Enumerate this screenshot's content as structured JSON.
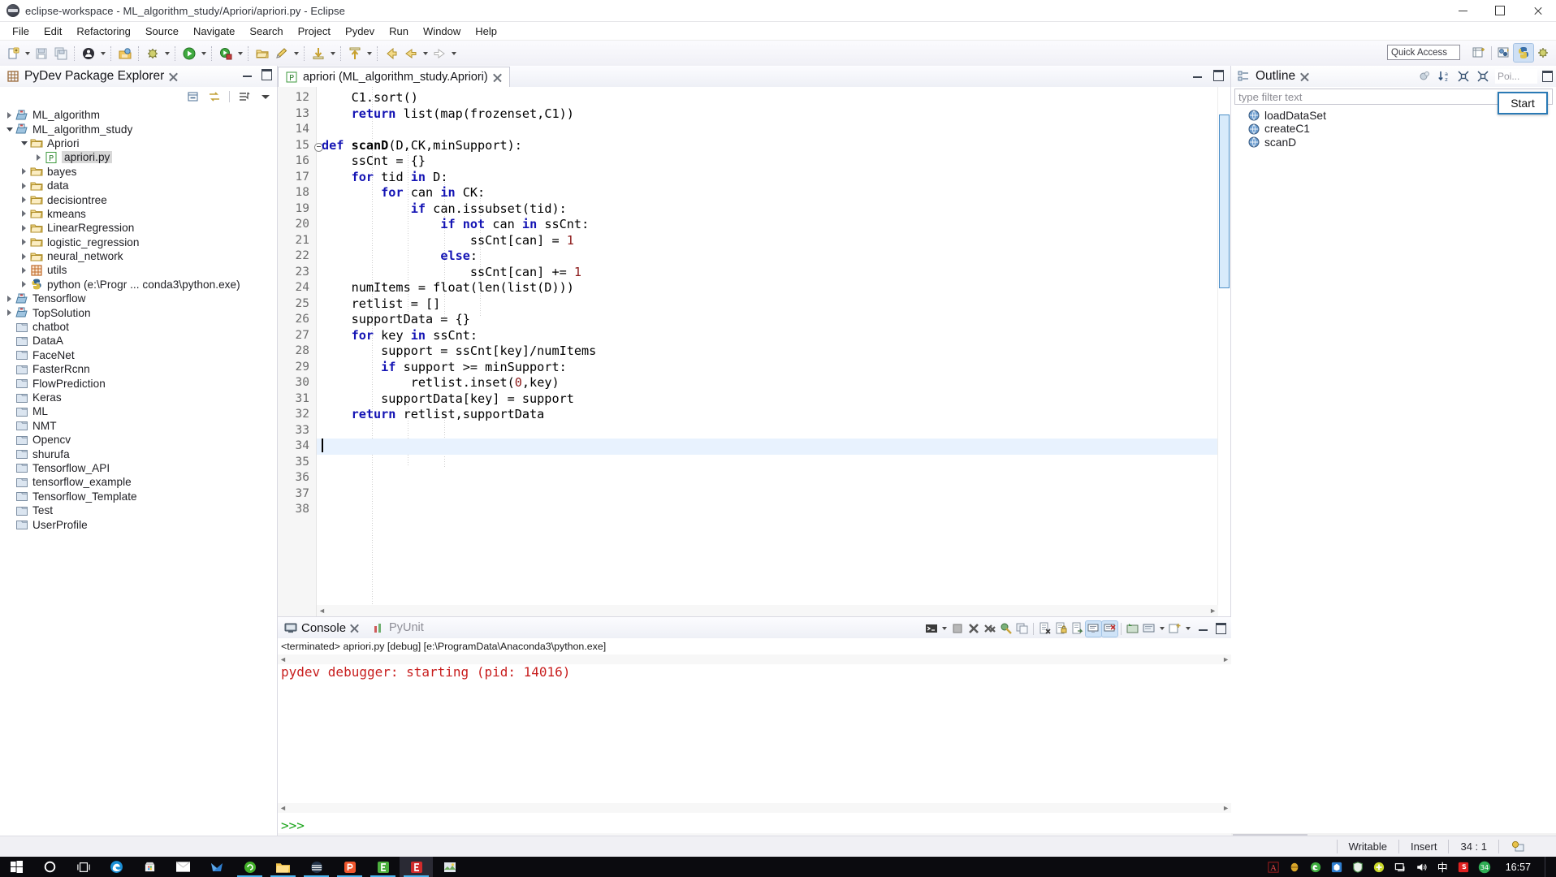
{
  "window": {
    "title": "eclipse-workspace - ML_algorithm_study/Apriori/apriori.py - Eclipse",
    "app_icon": "eclipse-icon",
    "minimize": "minimize-icon",
    "maximize": "maximize-icon",
    "close": "close-icon"
  },
  "menubar": {
    "items": [
      {
        "label": "File"
      },
      {
        "label": "Edit"
      },
      {
        "label": "Refactoring"
      },
      {
        "label": "Source"
      },
      {
        "label": "Navigate"
      },
      {
        "label": "Search"
      },
      {
        "label": "Project"
      },
      {
        "label": "Pydev"
      },
      {
        "label": "Run"
      },
      {
        "label": "Window"
      },
      {
        "label": "Help"
      }
    ]
  },
  "toolbar": {
    "quick_access": "Quick Access",
    "icons": [
      "new-file-icon",
      "save-icon",
      "save-all-icon",
      "debug-person-icon",
      "open-type-icon",
      "debug-bug-icon",
      "run-icon",
      "coverage-icon",
      "open-folder-icon",
      "pencil-icon",
      "step-into-icon",
      "step-return-icon",
      "back-arrow-icon",
      "prev-arrow-icon",
      "next-arrow-icon"
    ],
    "perspectives": [
      "new-perspective-icon",
      "java-perspective-icon",
      "pydev-perspective-icon",
      "debug-perspective-icon"
    ]
  },
  "explorer": {
    "title": "PyDev Package Explorer",
    "close_icon": "close-icon",
    "tools": [
      "collapse-all-icon",
      "link-with-editor-icon",
      "sort-filter-icon",
      "view-menu-icon"
    ],
    "minimize_icon": "minimize-icon",
    "maximize_icon": "maximize-icon",
    "tree": [
      {
        "label": "ML_algorithm",
        "icon": "pydev-project-icon",
        "indent": 0,
        "twist": "collapsed",
        "selected": false
      },
      {
        "label": "ML_algorithm_study",
        "icon": "pydev-project-icon",
        "indent": 0,
        "twist": "expanded",
        "selected": false
      },
      {
        "label": "Apriori",
        "icon": "package-folder-icon",
        "indent": 1,
        "twist": "expanded",
        "selected": false
      },
      {
        "label": "apriori.py",
        "icon": "python-file-icon",
        "indent": 2,
        "twist": "collapsed",
        "selected": true
      },
      {
        "label": "bayes",
        "icon": "package-folder-icon",
        "indent": 1,
        "twist": "collapsed",
        "selected": false
      },
      {
        "label": "data",
        "icon": "package-folder-icon",
        "indent": 1,
        "twist": "collapsed",
        "selected": false
      },
      {
        "label": "decisiontree",
        "icon": "package-folder-icon",
        "indent": 1,
        "twist": "collapsed",
        "selected": false
      },
      {
        "label": "kmeans",
        "icon": "package-folder-icon",
        "indent": 1,
        "twist": "collapsed",
        "selected": false
      },
      {
        "label": "LinearRegression",
        "icon": "package-folder-icon",
        "indent": 1,
        "twist": "collapsed",
        "selected": false
      },
      {
        "label": "logistic_regression",
        "icon": "package-folder-icon",
        "indent": 1,
        "twist": "collapsed",
        "selected": false
      },
      {
        "label": "neural_network",
        "icon": "package-folder-icon",
        "indent": 1,
        "twist": "collapsed",
        "selected": false
      },
      {
        "label": "utils",
        "icon": "grid-package-icon",
        "indent": 1,
        "twist": "collapsed",
        "selected": false
      },
      {
        "label": "python  (e:\\Progr ... conda3\\python.exe)",
        "icon": "python-interpreter-icon",
        "indent": 1,
        "twist": "collapsed",
        "selected": false
      },
      {
        "label": "Tensorflow",
        "icon": "pydev-project-icon",
        "indent": 0,
        "twist": "collapsed",
        "selected": false
      },
      {
        "label": "TopSolution",
        "icon": "pydev-project-icon",
        "indent": 0,
        "twist": "collapsed",
        "selected": false
      },
      {
        "label": "chatbot",
        "icon": "closed-project-icon",
        "indent": 0,
        "twist": "none",
        "selected": false
      },
      {
        "label": "DataA",
        "icon": "closed-project-icon",
        "indent": 0,
        "twist": "none",
        "selected": false
      },
      {
        "label": "FaceNet",
        "icon": "closed-project-icon",
        "indent": 0,
        "twist": "none",
        "selected": false
      },
      {
        "label": "FasterRcnn",
        "icon": "closed-project-icon",
        "indent": 0,
        "twist": "none",
        "selected": false
      },
      {
        "label": "FlowPrediction",
        "icon": "closed-project-icon",
        "indent": 0,
        "twist": "none",
        "selected": false
      },
      {
        "label": "Keras",
        "icon": "closed-project-icon",
        "indent": 0,
        "twist": "none",
        "selected": false
      },
      {
        "label": "ML",
        "icon": "closed-project-icon",
        "indent": 0,
        "twist": "none",
        "selected": false
      },
      {
        "label": "NMT",
        "icon": "closed-project-icon",
        "indent": 0,
        "twist": "none",
        "selected": false
      },
      {
        "label": "Opencv",
        "icon": "closed-project-icon",
        "indent": 0,
        "twist": "none",
        "selected": false
      },
      {
        "label": "shurufa",
        "icon": "closed-project-icon",
        "indent": 0,
        "twist": "none",
        "selected": false
      },
      {
        "label": "Tensorflow_API",
        "icon": "closed-project-icon",
        "indent": 0,
        "twist": "none",
        "selected": false
      },
      {
        "label": "tensorflow_example",
        "icon": "closed-project-icon",
        "indent": 0,
        "twist": "none",
        "selected": false
      },
      {
        "label": "Tensorflow_Template",
        "icon": "closed-project-icon",
        "indent": 0,
        "twist": "none",
        "selected": false
      },
      {
        "label": "Test",
        "icon": "closed-project-icon",
        "indent": 0,
        "twist": "none",
        "selected": false
      },
      {
        "label": "UserProfile",
        "icon": "closed-project-icon",
        "indent": 0,
        "twist": "none",
        "selected": false
      }
    ]
  },
  "editor": {
    "tab_label": "apriori (ML_algorithm_study.Apriori)",
    "tab_icon": "python-file-icon",
    "tab_close_icon": "close-icon",
    "minimize_icon": "minimize-icon",
    "maximize_icon": "maximize-icon",
    "first_line": 12,
    "current_line": 34,
    "lines": [
      {
        "n": 12,
        "fold": false,
        "tokens": [
          {
            "t": "    C1.sort()",
            "c": "pl"
          }
        ]
      },
      {
        "n": 13,
        "fold": false,
        "tokens": [
          {
            "t": "    ",
            "c": "pl"
          },
          {
            "t": "return",
            "c": "kw"
          },
          {
            "t": " list(map(frozenset,C1))",
            "c": "pl"
          }
        ]
      },
      {
        "n": 14,
        "fold": false,
        "tokens": [
          {
            "t": "",
            "c": "pl"
          }
        ]
      },
      {
        "n": 15,
        "fold": true,
        "tokens": [
          {
            "t": "def",
            "c": "kw"
          },
          {
            "t": " ",
            "c": "pl"
          },
          {
            "t": "scanD",
            "c": "fn"
          },
          {
            "t": "(D,CK,minSupport):",
            "c": "pl"
          }
        ]
      },
      {
        "n": 16,
        "fold": false,
        "tokens": [
          {
            "t": "    ssCnt = {}",
            "c": "pl"
          }
        ]
      },
      {
        "n": 17,
        "fold": false,
        "tokens": [
          {
            "t": "    ",
            "c": "pl"
          },
          {
            "t": "for",
            "c": "kw"
          },
          {
            "t": " tid ",
            "c": "pl"
          },
          {
            "t": "in",
            "c": "kw"
          },
          {
            "t": " D:",
            "c": "pl"
          }
        ]
      },
      {
        "n": 18,
        "fold": false,
        "tokens": [
          {
            "t": "        ",
            "c": "pl"
          },
          {
            "t": "for",
            "c": "kw"
          },
          {
            "t": " can ",
            "c": "pl"
          },
          {
            "t": "in",
            "c": "kw"
          },
          {
            "t": " CK:",
            "c": "pl"
          }
        ]
      },
      {
        "n": 19,
        "fold": false,
        "tokens": [
          {
            "t": "            ",
            "c": "pl"
          },
          {
            "t": "if",
            "c": "kw"
          },
          {
            "t": " can.issubset(tid):",
            "c": "pl"
          }
        ]
      },
      {
        "n": 20,
        "fold": false,
        "tokens": [
          {
            "t": "                ",
            "c": "pl"
          },
          {
            "t": "if",
            "c": "kw"
          },
          {
            "t": " ",
            "c": "pl"
          },
          {
            "t": "not",
            "c": "kw"
          },
          {
            "t": " can ",
            "c": "pl"
          },
          {
            "t": "in",
            "c": "kw"
          },
          {
            "t": " ssCnt:",
            "c": "pl"
          }
        ]
      },
      {
        "n": 21,
        "fold": false,
        "tokens": [
          {
            "t": "                    ssCnt[can] = ",
            "c": "pl"
          },
          {
            "t": "1",
            "c": "num"
          }
        ]
      },
      {
        "n": 22,
        "fold": false,
        "tokens": [
          {
            "t": "                ",
            "c": "pl"
          },
          {
            "t": "else",
            "c": "kw"
          },
          {
            "t": ":",
            "c": "pl"
          }
        ]
      },
      {
        "n": 23,
        "fold": false,
        "tokens": [
          {
            "t": "                    ssCnt[can] += ",
            "c": "pl"
          },
          {
            "t": "1",
            "c": "num"
          }
        ]
      },
      {
        "n": 24,
        "fold": false,
        "tokens": [
          {
            "t": "    numItems = float(len(list(D)))",
            "c": "pl"
          }
        ]
      },
      {
        "n": 25,
        "fold": false,
        "tokens": [
          {
            "t": "    retlist = []",
            "c": "pl"
          }
        ]
      },
      {
        "n": 26,
        "fold": false,
        "tokens": [
          {
            "t": "    supportData = {}",
            "c": "pl"
          }
        ]
      },
      {
        "n": 27,
        "fold": false,
        "tokens": [
          {
            "t": "    ",
            "c": "pl"
          },
          {
            "t": "for",
            "c": "kw"
          },
          {
            "t": " key ",
            "c": "pl"
          },
          {
            "t": "in",
            "c": "kw"
          },
          {
            "t": " ssCnt:",
            "c": "pl"
          }
        ]
      },
      {
        "n": 28,
        "fold": false,
        "tokens": [
          {
            "t": "        support = ssCnt[key]/numItems",
            "c": "pl"
          }
        ]
      },
      {
        "n": 29,
        "fold": false,
        "tokens": [
          {
            "t": "        ",
            "c": "pl"
          },
          {
            "t": "if",
            "c": "kw"
          },
          {
            "t": " support >= minSupport:",
            "c": "pl"
          }
        ]
      },
      {
        "n": 30,
        "fold": false,
        "tokens": [
          {
            "t": "            retlist.inset(",
            "c": "pl"
          },
          {
            "t": "0",
            "c": "num"
          },
          {
            "t": ",key)",
            "c": "pl"
          }
        ]
      },
      {
        "n": 31,
        "fold": false,
        "tokens": [
          {
            "t": "        supportData[key] = support",
            "c": "pl"
          }
        ]
      },
      {
        "n": 32,
        "fold": false,
        "tokens": [
          {
            "t": "    ",
            "c": "pl"
          },
          {
            "t": "return",
            "c": "kw"
          },
          {
            "t": " retlist,supportData",
            "c": "pl"
          }
        ]
      },
      {
        "n": 33,
        "fold": false,
        "tokens": [
          {
            "t": "",
            "c": "pl"
          }
        ]
      },
      {
        "n": 34,
        "fold": false,
        "tokens": [
          {
            "t": "",
            "c": "pl"
          }
        ]
      },
      {
        "n": 35,
        "fold": false,
        "tokens": [
          {
            "t": "",
            "c": "pl"
          }
        ]
      },
      {
        "n": 36,
        "fold": false,
        "tokens": [
          {
            "t": "",
            "c": "pl"
          }
        ]
      },
      {
        "n": 37,
        "fold": false,
        "tokens": [
          {
            "t": "",
            "c": "pl"
          }
        ]
      },
      {
        "n": 38,
        "fold": false,
        "tokens": [
          {
            "t": "",
            "c": "pl"
          }
        ]
      }
    ]
  },
  "console": {
    "tabs": [
      {
        "label": "Console",
        "icon": "console-icon",
        "active": true,
        "close_icon": "close-icon"
      },
      {
        "label": "PyUnit",
        "icon": "pyunit-icon",
        "active": false
      }
    ],
    "header": "<terminated> apriori.py [debug] [e:\\ProgramData\\Anaconda3\\python.exe]",
    "lines": [
      {
        "text": "pydev debugger: starting (pid: 14016)",
        "style": "err"
      },
      {
        "text": ">>>",
        "style": "prompt"
      }
    ],
    "tools": [
      "terminal-icon",
      "terminal-dropdown-icon",
      "stop-icon",
      "remove-launch-icon",
      "remove-all-icon",
      "pin-console-icon",
      "open-console-icon",
      "clear-console-icon",
      "lock-scroll-icon",
      "word-wrap-icon",
      "show-on-output-icon",
      "show-on-error-icon",
      "display-console-icon",
      "open-console-menu-icon",
      "new-console-icon",
      "minimize-icon",
      "maximize-icon"
    ]
  },
  "outline": {
    "title": "Outline",
    "close_icon": "close-icon",
    "tools": [
      "hide-fields-icon",
      "sort-alpha-icon",
      "collapse-all-icon",
      "expand-all-icon"
    ],
    "poi_label": "Poi...",
    "filter_placeholder": "type filter text",
    "start_tooltip": "Start",
    "items": [
      {
        "label": "loadDataSet",
        "icon": "method-icon"
      },
      {
        "label": "createC1",
        "icon": "method-icon"
      },
      {
        "label": "scanD",
        "icon": "method-icon"
      }
    ]
  },
  "statusbar": {
    "writable": "Writable",
    "insert": "Insert",
    "position": "34 : 1",
    "icon": "editor-status-icon"
  },
  "taskbar": {
    "items": [
      {
        "name": "start-button",
        "icon": "windows-logo-icon",
        "open": false
      },
      {
        "name": "cortana-button",
        "icon": "cortana-circle-icon",
        "open": false
      },
      {
        "name": "task-view-button",
        "icon": "task-view-icon",
        "open": false
      },
      {
        "name": "edge-button",
        "icon": "edge-browser-icon",
        "open": false
      },
      {
        "name": "store-button",
        "icon": "microsoft-store-icon",
        "open": false
      },
      {
        "name": "mail-button",
        "icon": "mail-icon",
        "open": false
      },
      {
        "name": "foxmail-button",
        "icon": "foxmail-icon",
        "open": false
      },
      {
        "name": "anaconda-button",
        "icon": "green-circle-icon",
        "open": true
      },
      {
        "name": "explorer-button",
        "icon": "file-explorer-icon",
        "open": true
      },
      {
        "name": "ppt-button",
        "icon": "dark-circle-icon",
        "open": true
      },
      {
        "name": "pdf-button",
        "icon": "orange-p-icon",
        "open": true
      },
      {
        "name": "excel-button",
        "icon": "green-e-icon",
        "open": true
      },
      {
        "name": "eclipse-button",
        "icon": "red-e-icon",
        "open": true,
        "active": true
      },
      {
        "name": "screenshot-button",
        "icon": "picture-icon",
        "open": false
      }
    ],
    "tray": [
      {
        "name": "acrobat-tray-icon",
        "icon": "adobe-icon"
      },
      {
        "name": "lantern-tray-icon",
        "icon": "lantern-icon"
      },
      {
        "name": "green-browser-tray-icon",
        "icon": "green-e-icon"
      },
      {
        "name": "cloud-tray-icon",
        "icon": "blue-box-icon"
      },
      {
        "name": "security-tray-icon",
        "icon": "shield-icon"
      },
      {
        "name": "update-tray-icon",
        "icon": "plus-circle-icon"
      },
      {
        "name": "network-tray-icon",
        "icon": "monitor-icon"
      },
      {
        "name": "volume-tray-icon",
        "icon": "speaker-icon"
      },
      {
        "name": "ime-tray-icon",
        "icon": "chinese-ime-icon",
        "text": "中"
      },
      {
        "name": "sogou-tray-icon",
        "icon": "sogou-s-icon"
      },
      {
        "name": "rising-tray-icon",
        "icon": "green-badge-icon",
        "text": "34"
      }
    ],
    "clock": "16:57"
  }
}
